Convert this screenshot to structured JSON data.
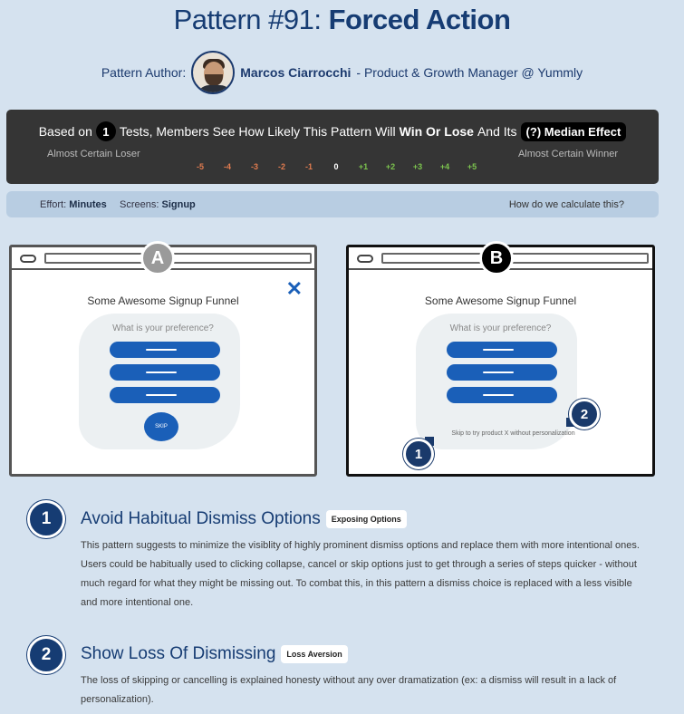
{
  "header": {
    "title_prefix": "Pattern #91:",
    "title_bold": "Forced Action",
    "author_label": "Pattern Author:",
    "author_name": "Marcos Ciarrocchi",
    "author_role": "- Product & Growth Manager @ Yummly"
  },
  "results": {
    "based_on": "Based on",
    "tests_count": "1",
    "mid_text": "Tests, Members See How Likely This Pattern Will",
    "win_or_lose": "Win Or Lose",
    "and_its": "And Its",
    "median_effect": "(?) Median Effect",
    "left_label": "Almost Certain Loser",
    "right_label": "Almost Certain Winner",
    "scale": [
      {
        "label": "-5",
        "color": "#e07b4f"
      },
      {
        "label": "-4",
        "color": "#e07b4f"
      },
      {
        "label": "-3",
        "color": "#e07b4f"
      },
      {
        "label": "-2",
        "color": "#e07b4f"
      },
      {
        "label": "-1",
        "color": "#e07b4f"
      },
      {
        "label": "0",
        "color": "#ffffff"
      },
      {
        "label": "+1",
        "color": "#7cc44e"
      },
      {
        "label": "+2",
        "color": "#7cc44e"
      },
      {
        "label": "+3",
        "color": "#7cc44e"
      },
      {
        "label": "+4",
        "color": "#7cc44e"
      },
      {
        "label": "+5",
        "color": "#7cc44e"
      }
    ]
  },
  "info": {
    "effort_label": "Effort:",
    "effort_value": "Minutes",
    "screens_label": "Screens:",
    "screens_value": "Signup",
    "how_link": "How do we calculate this?"
  },
  "variant_a": {
    "badge": "A",
    "funnel_title": "Some Awesome Signup Funnel",
    "question": "What is your preference?",
    "skip_button": "SKIP",
    "close_icon": "close-x"
  },
  "variant_b": {
    "badge": "B",
    "funnel_title": "Some Awesome Signup Funnel",
    "question": "What is your preference?",
    "skip_link": "Skip to try product X without personalization",
    "marker_1": "1",
    "marker_2": "2"
  },
  "principles": [
    {
      "number": "1",
      "title": "Avoid Habitual Dismiss Options",
      "tag": "Exposing Options",
      "description": "This pattern suggests to minimize the visiblity of highly prominent dismiss options and replace them with more intentional ones. Users could be habitually used to clicking collapse, cancel or skip options just to get through a series of steps quicker - without much regard for what they might be missing out. To combat this, in this pattern a dismiss choice is replaced with a less visible and more intentional one."
    },
    {
      "number": "2",
      "title": "Show Loss Of Dismissing",
      "tag": "Loss Aversion",
      "description": "The loss of skipping or cancelling is explained honesty without any over dramatization (ex: a dismiss will result in a lack of personalization)."
    }
  ],
  "colors": {
    "accent": "#163c73",
    "button_blue": "#1a5fb8",
    "background": "#d5e2ef"
  }
}
